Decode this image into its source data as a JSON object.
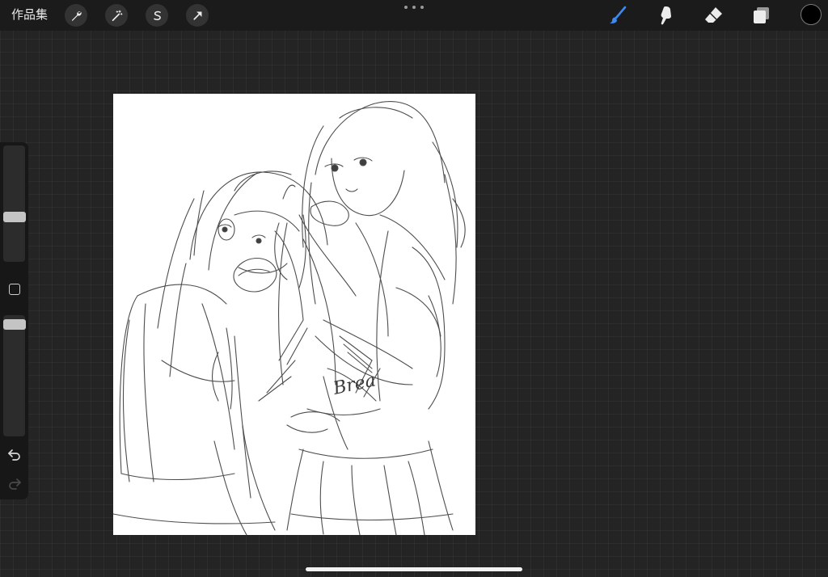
{
  "topbar": {
    "gallery_label": "作品集",
    "left_tools": [
      {
        "name": "actions",
        "icon": "wrench-icon"
      },
      {
        "name": "adjustments",
        "icon": "magic-wand-icon"
      },
      {
        "name": "selection",
        "icon": "selection-s-icon"
      },
      {
        "name": "transform",
        "icon": "arrow-cursor-icon"
      }
    ],
    "more_icon": "ellipsis-icon",
    "right_tools": [
      {
        "name": "brush",
        "icon": "brush-icon",
        "active": true
      },
      {
        "name": "smudge",
        "icon": "smudge-icon",
        "active": false
      },
      {
        "name": "eraser",
        "icon": "eraser-icon",
        "active": false
      },
      {
        "name": "layers",
        "icon": "layers-icon",
        "active": false
      }
    ],
    "current_color": "#000000"
  },
  "sidebar": {
    "brush_size_level": 0.4,
    "brush_opacity_level": 0.95,
    "modify_icon": "square-icon",
    "undo_icon": "undo-icon",
    "redo_icon": "redo-icon",
    "redo_enabled": false
  },
  "canvas": {
    "background": "#ffffff",
    "content": "pencil-sketch",
    "sketch_text": "Brea"
  },
  "colors": {
    "accent": "#3d8bf2",
    "background": "#242424",
    "toolbar": "#1b1b1b"
  }
}
